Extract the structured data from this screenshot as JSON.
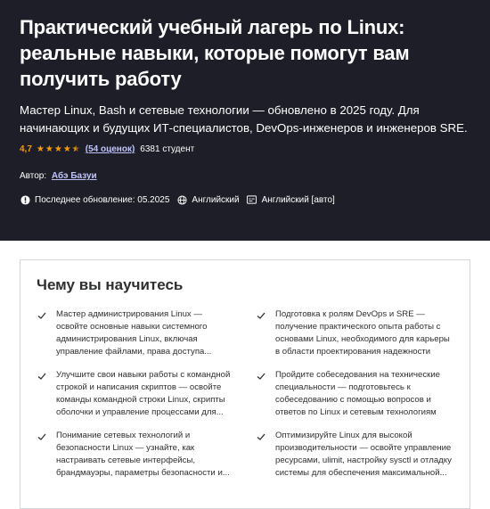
{
  "course": {
    "title": "Практический учебный лагерь по Linux: реальные навыки, которые помогут вам получить работу",
    "subtitle": "Мастер Linux, Bash и сетевые технологии — обновлено в 2025 году. Для начинающих и будущих ИТ-специалистов, DevOps-инженеров и инженеров SRE.",
    "rating_value": "4,7",
    "rating_stars": 4.7,
    "reviews_link": "(54 оценок)",
    "students": "6381 студент",
    "author_label": "Автор:",
    "author_name": "Абэ Базуи",
    "last_updated": "Последнее обновление: 05.2025",
    "language": "Английский",
    "captions": "Английский [авто]"
  },
  "colors": {
    "hero_bg": "#1d1e27",
    "star": "#f69c08",
    "link": "#c0c4fc"
  },
  "learn": {
    "heading": "Чему вы научитесь",
    "items": [
      "Мастер администрирования Linux — освойте основные навыки системного администрирования Linux, включая управление файлами, права доступа...",
      "Подготовка к ролям DevOps и SRE — получение практического опыта работы с основами Linux, необходимого для карьеры в области проектирования надежности сайта...",
      "Улучшите свои навыки работы с командной строкой и написания скриптов — освойте команды командной строки Linux, скрипты оболочки и управление процессами для...",
      "Пройдите собеседования на технические специальности — подготовьтесь к собеседованию с помощью вопросов и ответов по Linux и сетевым технологиям из...",
      "Понимание сетевых технологий и безопасности Linux — узнайте, как настраивать сетевые интерфейсы, брандмауэры, параметры безопасности и...",
      "Оптимизируйте Linux для высокой производительности — освойте управление ресурсами, ulimit, настройку sysctl и отладку системы для обеспечения максимальной..."
    ]
  }
}
